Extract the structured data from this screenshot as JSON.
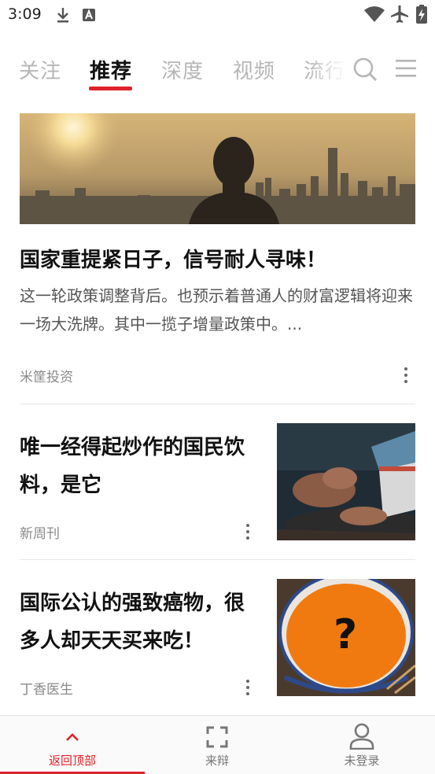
{
  "status_bar": {
    "time": "3:09"
  },
  "tabs": [
    {
      "label": "关注"
    },
    {
      "label": "推荐"
    },
    {
      "label": "深度"
    },
    {
      "label": "视频"
    },
    {
      "label": "流行"
    }
  ],
  "feature": {
    "title": "国家重提紧日子，信号耐人寻味！",
    "description": "这一轮政策调整背后。也预示着普通人的财富逻辑将迎来一场大洗牌。其中一揽子增量政策中。...",
    "source": "米筐投资"
  },
  "items": [
    {
      "title": "唯一经得起炒作的国民饮料，是它",
      "source": "新周刊"
    },
    {
      "title": "国际公认的强致癌物，很多人却天天买来吃！",
      "source": "丁香医生"
    }
  ],
  "bottom_nav": [
    {
      "label": "返回顶部"
    },
    {
      "label": "来辩"
    },
    {
      "label": "未登录"
    }
  ],
  "colors": {
    "accent": "#e0222a",
    "inactive_tab": "#b6b6b6"
  }
}
